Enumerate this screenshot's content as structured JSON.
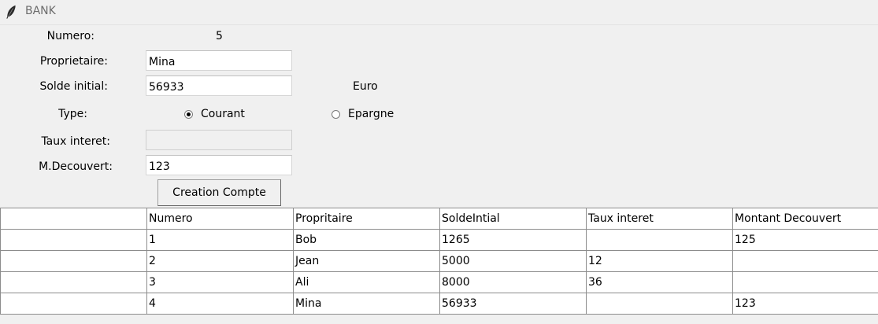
{
  "window": {
    "title": "BANK",
    "icon": "feather-icon"
  },
  "form": {
    "numero_label": "Numero:",
    "numero_value": "5",
    "proprietaire_label": "Proprietaire:",
    "proprietaire_value": "Mina",
    "solde_label": "Solde initial:",
    "solde_value": "56933",
    "currency_label": "Euro",
    "type_label": "Type:",
    "type_options": [
      "Courant",
      "Epargne"
    ],
    "type_selected": "Courant",
    "taux_label": "Taux interet:",
    "taux_value": "",
    "decouvert_label": "M.Decouvert:",
    "decouvert_value": "123",
    "create_button_label": "Creation Compte"
  },
  "table": {
    "headers": [
      "",
      "Numero",
      "Propritaire",
      "SoldeIntial",
      "Taux interet",
      "Montant Decouvert"
    ],
    "rows": [
      [
        "",
        "1",
        "Bob",
        "1265",
        "",
        "125"
      ],
      [
        "",
        "2",
        "Jean",
        "5000",
        "12",
        ""
      ],
      [
        "",
        "3",
        "Ali",
        "8000",
        "36",
        ""
      ],
      [
        "",
        "4",
        "Mina",
        "56933",
        "",
        "123"
      ]
    ]
  }
}
